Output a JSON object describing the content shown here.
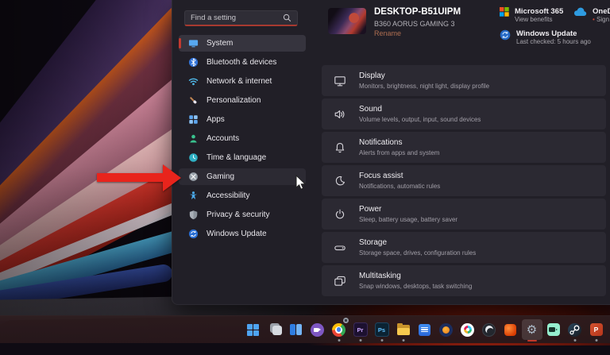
{
  "window": {
    "search_placeholder": "Find a setting"
  },
  "sidebar": {
    "items": [
      {
        "label": "System",
        "icon": "system-icon",
        "state": "selected"
      },
      {
        "label": "Bluetooth & devices",
        "icon": "bluetooth-icon",
        "state": "normal"
      },
      {
        "label": "Network & internet",
        "icon": "network-icon",
        "state": "normal"
      },
      {
        "label": "Personalization",
        "icon": "personalization-icon",
        "state": "normal"
      },
      {
        "label": "Apps",
        "icon": "apps-icon",
        "state": "normal"
      },
      {
        "label": "Accounts",
        "icon": "accounts-icon",
        "state": "normal"
      },
      {
        "label": "Time & language",
        "icon": "time-language-icon",
        "state": "normal"
      },
      {
        "label": "Gaming",
        "icon": "gaming-icon",
        "state": "hover"
      },
      {
        "label": "Accessibility",
        "icon": "accessibility-icon",
        "state": "normal"
      },
      {
        "label": "Privacy & security",
        "icon": "privacy-icon",
        "state": "normal"
      },
      {
        "label": "Windows Update",
        "icon": "windows-update-icon",
        "state": "normal"
      }
    ]
  },
  "header": {
    "device_name": "DESKTOP-B51UIPM",
    "device_model": "B360 AORUS GAMING 3",
    "rename_label": "Rename"
  },
  "cards": {
    "microsoft365": {
      "title": "Microsoft 365",
      "subtitle": "View benefits"
    },
    "onedrive": {
      "title": "OneDrive",
      "subtitle": "Sign in",
      "bullet": "•"
    },
    "windows_update": {
      "title": "Windows Update",
      "subtitle": "Last checked: 5 hours ago"
    }
  },
  "settings_rows": [
    {
      "title": "Display",
      "subtitle": "Monitors, brightness, night light, display profile",
      "icon": "display-icon"
    },
    {
      "title": "Sound",
      "subtitle": "Volume levels, output, input, sound devices",
      "icon": "sound-icon"
    },
    {
      "title": "Notifications",
      "subtitle": "Alerts from apps and system",
      "icon": "notifications-icon"
    },
    {
      "title": "Focus assist",
      "subtitle": "Notifications, automatic rules",
      "icon": "focus-assist-icon"
    },
    {
      "title": "Power",
      "subtitle": "Sleep, battery usage, battery saver",
      "icon": "power-icon"
    },
    {
      "title": "Storage",
      "subtitle": "Storage space, drives, configuration rules",
      "icon": "storage-icon"
    },
    {
      "title": "Multitasking",
      "subtitle": "Snap windows, desktops, task switching",
      "icon": "multitasking-icon"
    }
  ],
  "taskbar": {
    "premiere_label": "Pr",
    "photoshop_label": "Ps",
    "powerpoint_label": "P",
    "gear_glyph": "⚙",
    "icons": [
      {
        "name": "start-icon"
      },
      {
        "name": "task-view-icon"
      },
      {
        "name": "widgets-panes-icon"
      },
      {
        "name": "meet-icon"
      },
      {
        "name": "chrome-icon"
      },
      {
        "name": "premiere-pro-icon"
      },
      {
        "name": "photoshop-icon"
      },
      {
        "name": "file-explorer-icon"
      },
      {
        "name": "notes-app-icon"
      },
      {
        "name": "orange-circle-app-icon"
      },
      {
        "name": "slack-icon"
      },
      {
        "name": "obs-studio-icon"
      },
      {
        "name": "office-icon"
      },
      {
        "name": "settings-gear-icon"
      },
      {
        "name": "screen-recorder-icon"
      },
      {
        "name": "steam-icon"
      },
      {
        "name": "powerpoint-icon"
      },
      {
        "name": "overflow-app-icon"
      }
    ]
  },
  "colors": {
    "accent_red": "#c23a30",
    "search_underline": "#a83a30",
    "rename_link": "#ae6e51",
    "window_bg": "#211f27",
    "row_bg": "#2b2932"
  }
}
